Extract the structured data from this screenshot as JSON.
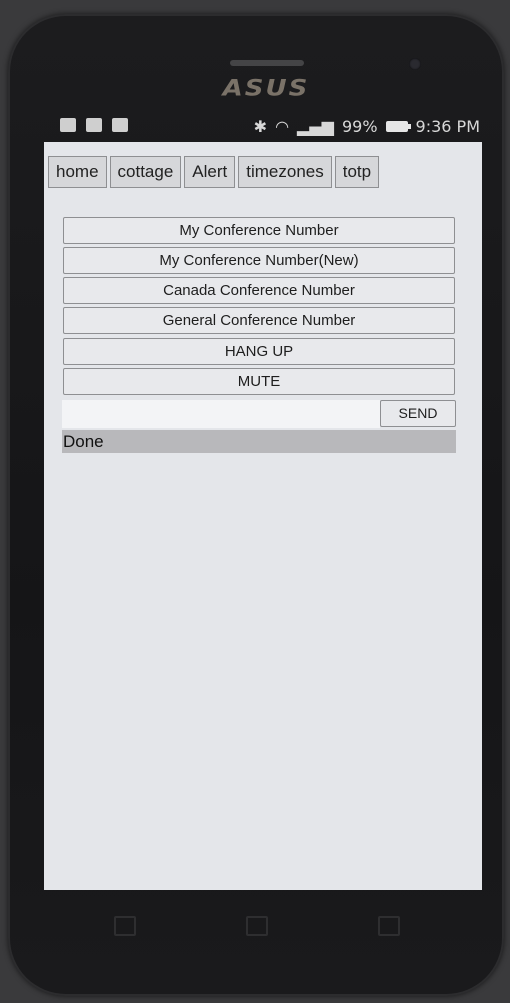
{
  "device": {
    "brand_logo": "ASUS"
  },
  "statusbar": {
    "battery": "99%",
    "time": "9:36 PM"
  },
  "tabs": [
    {
      "label": "home"
    },
    {
      "label": "cottage"
    },
    {
      "label": "Alert"
    },
    {
      "label": "timezones"
    },
    {
      "label": "totp"
    }
  ],
  "buttons": [
    {
      "label": "My Conference Number"
    },
    {
      "label": "My Conference Number(New)"
    },
    {
      "label": "Canada Conference Number"
    },
    {
      "label": "General Conference Number"
    },
    {
      "label": "HANG UP"
    },
    {
      "label": "MUTE"
    }
  ],
  "send": {
    "input_value": "",
    "button_label": "SEND"
  },
  "status_text": "Done"
}
